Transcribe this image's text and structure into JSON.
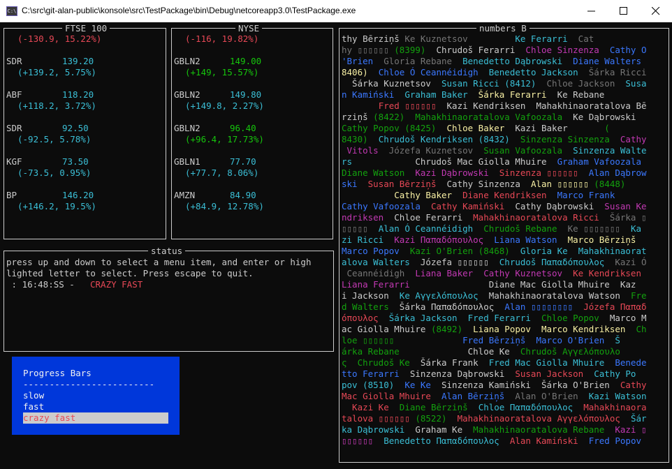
{
  "window": {
    "title": "C:\\src\\git-alan-public\\konsole\\src\\TestPackage\\bin\\Debug\\netcoreapp3.0\\TestPackage.exe",
    "icon": "console-app-icon"
  },
  "ftse": {
    "title": "FTSE 100",
    "summary": "(-130.9, 15.22%)",
    "rows": [
      {
        "symbol": "SDR",
        "price": "139.20",
        "change": "(+139.2, 5.75%)"
      },
      {
        "symbol": "ABF",
        "price": "118.20",
        "change": "(+118.2, 3.72%)"
      },
      {
        "symbol": "SDR",
        "price": "92.50",
        "change": "(-92.5, 5.78%)"
      },
      {
        "symbol": "KGF",
        "price": "73.50",
        "change": "(-73.5, 0.95%)"
      },
      {
        "symbol": "BP",
        "price": "146.20",
        "change": "(+146.2, 19.5%)"
      }
    ]
  },
  "nyse": {
    "title": "NYSE",
    "summary": "(-116, 19.82%)",
    "rows": [
      {
        "symbol": "GBLN2",
        "price": "149.00",
        "change": "(+149, 15.57%)"
      },
      {
        "symbol": "GBLN2",
        "price": "149.80",
        "change": "(+149.8, 2.27%)"
      },
      {
        "symbol": "GBLN2",
        "price": "96.40",
        "change": "(+96.4, 17.73%)"
      },
      {
        "symbol": "GBLN1",
        "price": "77.70",
        "change": "(+77.7, 8.06%)"
      },
      {
        "symbol": "AMZN",
        "price": "84.90",
        "change": "(+84.9, 12.78%)"
      }
    ]
  },
  "status": {
    "title": "status",
    "line1": "press up and down to select a menu item, and enter or high",
    "line2": "lighted letter to select. Press escape to quit.",
    "time": " : 16:48:SS - ",
    "mode": "CRAZY FAST"
  },
  "menu": {
    "title": "Progress Bars",
    "separator": "-------------------------",
    "items": [
      "slow",
      "fast",
      "crazy fast"
    ]
  },
  "numbers": {
    "title": "numbers B",
    "lines": [
      [
        [
          "thy Bērziņš ",
          "white"
        ],
        [
          "Ke Kuznetsov",
          "gray"
        ],
        [
          "         ",
          ""
        ],
        [
          "Ke Ferarri",
          "cyan"
        ],
        [
          "  Cat",
          "gray"
        ]
      ],
      [
        [
          "hy ▯▯▯▯▯▯ ",
          "gray"
        ],
        [
          "(8399)",
          "green"
        ],
        [
          "  Chrudoš Ferarri  ",
          "white"
        ],
        [
          "Chloe Sinzenza",
          "magenta"
        ],
        [
          "  Cathy O",
          "blue"
        ]
      ],
      [
        [
          "'Brien  ",
          "blue"
        ],
        [
          "Gloria Rebane  ",
          "gray"
        ],
        [
          "Benedetto Dąbrowski  ",
          "cyan"
        ],
        [
          "Diane Walters",
          "blue"
        ]
      ],
      [
        [
          "8406)  ",
          "yellow"
        ],
        [
          "Chloe Ó Ceannéidigh  ",
          "blue"
        ],
        [
          "Benedetto Jackson  ",
          "cyan"
        ],
        [
          "Šárka Ricci",
          "gray"
        ]
      ],
      [
        [
          "  Šárka Kuznetsov  ",
          "white"
        ],
        [
          "Susan Ricci (8412)  ",
          "cyan"
        ],
        [
          "Chloe Jackson  ",
          "gray"
        ],
        [
          "Susa",
          "cyan"
        ]
      ],
      [
        [
          "n Kamiński  ",
          "blue"
        ],
        [
          "Graham Baker  ",
          "cyan"
        ],
        [
          "Šárka Ferarri  ",
          "yellow"
        ],
        [
          "Ke Rebane",
          "white"
        ]
      ],
      [
        [
          "       ",
          ""
        ],
        [
          "Fred ▯▯▯▯▯▯  ",
          "red"
        ],
        [
          "Kazi Kendriksen  ",
          "white"
        ],
        [
          "Mahakhinaoratalova Bē",
          "white"
        ]
      ],
      [
        [
          "rziņš ",
          "white"
        ],
        [
          "(8422)  ",
          "green"
        ],
        [
          "Mahakhinaoratalova Vafoozala  ",
          "green"
        ],
        [
          "Ke Dąbrowski",
          "white"
        ]
      ],
      [
        [
          "Cathy Popov (8425)  ",
          "green"
        ],
        [
          "Chloe Baker  ",
          "yellow"
        ],
        [
          "Kazi Baker       ",
          "white"
        ],
        [
          "(",
          "green"
        ]
      ],
      [
        [
          "8430)  ",
          "green"
        ],
        [
          "Chrudoš Kendriksen (8432)  ",
          "cyan"
        ],
        [
          "Sinzenza Sinzenza  ",
          "green"
        ],
        [
          "Cathy",
          "magenta"
        ]
      ],
      [
        [
          " Vitols  ",
          "magenta"
        ],
        [
          "Józefa Kuznetsov  ",
          "gray"
        ],
        [
          "Susan Vafoozala  ",
          "green"
        ],
        [
          "Sinzenza Walte",
          "cyan"
        ]
      ],
      [
        [
          "rs            ",
          "cyan"
        ],
        [
          "Chrudoš Mac Giolla Mhuire  ",
          "white"
        ],
        [
          "Graham Vafoozala",
          "blue"
        ]
      ],
      [
        [
          "Diane Watson  ",
          "green"
        ],
        [
          "Kazi Dąbrowski  ",
          "magenta"
        ],
        [
          "Sinzenza ▯▯▯▯▯▯  ",
          "red"
        ],
        [
          "Alan Dąbrow",
          "blue"
        ]
      ],
      [
        [
          "ski  ",
          "blue"
        ],
        [
          "Susan Bērziņš  ",
          "red"
        ],
        [
          "Cathy Sinzenza  ",
          "white"
        ],
        [
          "Alan ▯▯▯▯▯▯ ",
          "yellow"
        ],
        [
          "(8448)",
          "green"
        ]
      ],
      [
        [
          "          ",
          ""
        ],
        [
          "Cathy Baker  ",
          "yellow"
        ],
        [
          "Diane Kendriksen  ",
          "red"
        ],
        [
          "Marco Frank",
          "blue"
        ]
      ],
      [
        [
          "Cathy Vafoozala  ",
          "blue"
        ],
        [
          "Cathy Kamiński  ",
          "red"
        ],
        [
          "Cathy Dąbrowski  ",
          "white"
        ],
        [
          "Susan Ke",
          "magenta"
        ]
      ],
      [
        [
          "ndriksen  ",
          "magenta"
        ],
        [
          "Chloe Ferarri  ",
          "white"
        ],
        [
          "Mahakhinaoratalova Ricci  ",
          "red"
        ],
        [
          "Šárka ▯",
          "gray"
        ]
      ],
      [
        [
          "▯▯▯▯▯  ",
          "gray"
        ],
        [
          "Alan Ó Ceannéidigh  ",
          "cyan"
        ],
        [
          "Chrudoš Rebane  ",
          "green"
        ],
        [
          "Ke ▯▯▯▯▯▯▯  ",
          "gray"
        ],
        [
          "Ka",
          "cyan"
        ]
      ],
      [
        [
          "zi Ricci  ",
          "cyan"
        ],
        [
          "Kazi Παπαδόπουλος  ",
          "magenta"
        ],
        [
          "Liana Watson  ",
          "blue"
        ],
        [
          "Marco Bērziņš",
          "yellow"
        ]
      ],
      [
        [
          "Marco Popov  ",
          "blue"
        ],
        [
          "Kazi O'Brien (8468)  ",
          "green"
        ],
        [
          "Gloria Ke  ",
          "cyan"
        ],
        [
          "Mahakhinaorat",
          "cyan"
        ]
      ],
      [
        [
          "alova Walters  ",
          "cyan"
        ],
        [
          "Józefa ▯▯▯▯▯▯  ",
          "white"
        ],
        [
          "Chrudoš Παπαδόπουλος  ",
          "cyan"
        ],
        [
          "Kazi Ó",
          "gray"
        ]
      ],
      [
        [
          " Ceannéidigh  ",
          "gray"
        ],
        [
          "Liana Baker  ",
          "magenta"
        ],
        [
          "Cathy Kuznetsov  ",
          "magenta"
        ],
        [
          "Ke Kendriksen",
          "red"
        ]
      ],
      [
        [
          "Liana Ferarri               ",
          "magenta"
        ],
        [
          "Diane Mac Giolla Mhuire  ",
          "white"
        ],
        [
          "Kaz",
          "white"
        ]
      ],
      [
        [
          "i Jackson  ",
          "white"
        ],
        [
          "Ke Αγγελόπουλος  ",
          "cyan"
        ],
        [
          "Mahakhinaoratalova Watson  ",
          "white"
        ],
        [
          "Fre",
          "green"
        ]
      ],
      [
        [
          "d Walters  ",
          "green"
        ],
        [
          "Šárka Παπαδόπουλος  ",
          "white"
        ],
        [
          "Alan ▯▯▯▯▯▯▯▯  ",
          "blue"
        ],
        [
          "Józefa Παπαδ",
          "red"
        ]
      ],
      [
        [
          "όπουλος  ",
          "red"
        ],
        [
          "Šárka Jackson  ",
          "cyan"
        ],
        [
          "Fred Ferarri  ",
          "cyan"
        ],
        [
          "Chloe Popov  ",
          "green"
        ],
        [
          "Marco M",
          "white"
        ]
      ],
      [
        [
          "ac Giolla Mhuire ",
          "white"
        ],
        [
          "(8492)  ",
          "green"
        ],
        [
          "Liana Popov  ",
          "yellow"
        ],
        [
          "Marco Kendriksen  ",
          "yellow"
        ],
        [
          "Ch",
          "green"
        ]
      ],
      [
        [
          "loe ▯▯▯▯▯▯             ",
          "green"
        ],
        [
          "Fred Bērziņš  ",
          "blue"
        ],
        [
          "Marco O'Brien  ",
          "blue"
        ],
        [
          "Š",
          "cyan"
        ]
      ],
      [
        [
          "árka Rebane             ",
          "green"
        ],
        [
          "Chloe Ke  ",
          "white"
        ],
        [
          "Chrudoš Αγγελόπουλο",
          "green"
        ]
      ],
      [
        [
          "ς  ",
          "green"
        ],
        [
          "Chrudoš Ke  ",
          "green"
        ],
        [
          "Šárka Frank  ",
          "white"
        ],
        [
          "Fred Mac Giolla Mhuire  ",
          "cyan"
        ],
        [
          "Benede",
          "blue"
        ]
      ],
      [
        [
          "tto Ferarri  ",
          "blue"
        ],
        [
          "Sinzenza Dąbrowski  ",
          "white"
        ],
        [
          "Susan Jackson  ",
          "red"
        ],
        [
          "Cathy Po",
          "cyan"
        ]
      ],
      [
        [
          "pov (8510)  ",
          "cyan"
        ],
        [
          "Ke Ke  ",
          "blue"
        ],
        [
          "Sinzenza Kamiński  ",
          "white"
        ],
        [
          "Šárka O'Brien  ",
          "white"
        ],
        [
          "Cathy",
          "red"
        ]
      ],
      [
        [
          "Mac Giolla Mhuire  ",
          "red"
        ],
        [
          "Alan Bērziņš  ",
          "blue"
        ],
        [
          "Alan O'Brien  ",
          "gray"
        ],
        [
          "Kazi Watson",
          "cyan"
        ]
      ],
      [
        [
          "  Kazi Ke  ",
          "red"
        ],
        [
          "Diane Bērziņš  ",
          "green"
        ],
        [
          "Chloe Παπαδόπουλος  ",
          "cyan"
        ],
        [
          "Mahakhinaora",
          "red"
        ]
      ],
      [
        [
          "talova ▯▯▯▯▯▯ ",
          "red"
        ],
        [
          "(8522)  ",
          "green"
        ],
        [
          "Mahakhinaoratalova Αγγελόπουλος  ",
          "red"
        ],
        [
          "Šár",
          "cyan"
        ]
      ],
      [
        [
          "ka Dąbrowski  ",
          "cyan"
        ],
        [
          "Graham Ke  ",
          "white"
        ],
        [
          "Mahakhinaoratalova Rebane  ",
          "green"
        ],
        [
          "Kazi ▯",
          "magenta"
        ]
      ],
      [
        [
          "▯▯▯▯▯▯  ",
          "magenta"
        ],
        [
          "Benedetto Παπαδόπουλος  ",
          "cyan"
        ],
        [
          "Alan Kamiński  ",
          "red"
        ],
        [
          "Fred Popov",
          "blue"
        ]
      ]
    ]
  },
  "colors": {
    "white": "#cccccc",
    "gray": "#767676",
    "cyan": "#3bbfd6",
    "blue": "#3b78ff",
    "red": "#e74856",
    "green": "#13a10e",
    "lgreen": "#16c60c",
    "magenta": "#c239b3",
    "yellow": "#f9f1a5",
    "menu_bg": "#0037da"
  }
}
